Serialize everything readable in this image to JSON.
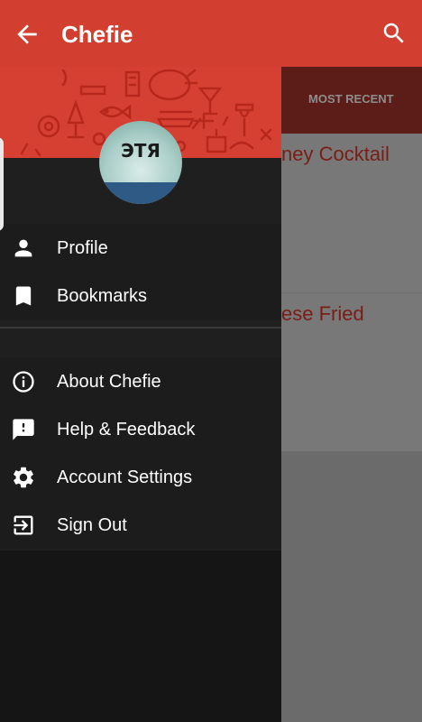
{
  "appbar": {
    "title": "Chefie",
    "back_icon": "arrow-back-icon",
    "search_icon": "search-icon",
    "color": "#d23f31"
  },
  "background": {
    "tab_label": "MOST RECENT",
    "card1_text": "ney Cocktail",
    "card2_text": "ese Fried"
  },
  "drawer": {
    "avatar_logo_text": "ЭТЯ",
    "primary_items": [
      {
        "label": "Profile",
        "icon": "person-icon"
      },
      {
        "label": "Bookmarks",
        "icon": "bookmark-icon"
      }
    ],
    "secondary_items": [
      {
        "label": "About Chefie",
        "icon": "info-icon"
      },
      {
        "label": "Help & Feedback",
        "icon": "feedback-icon"
      },
      {
        "label": "Account Settings",
        "icon": "settings-gear-icon"
      },
      {
        "label": "Sign Out",
        "icon": "sign-out-icon"
      }
    ]
  }
}
